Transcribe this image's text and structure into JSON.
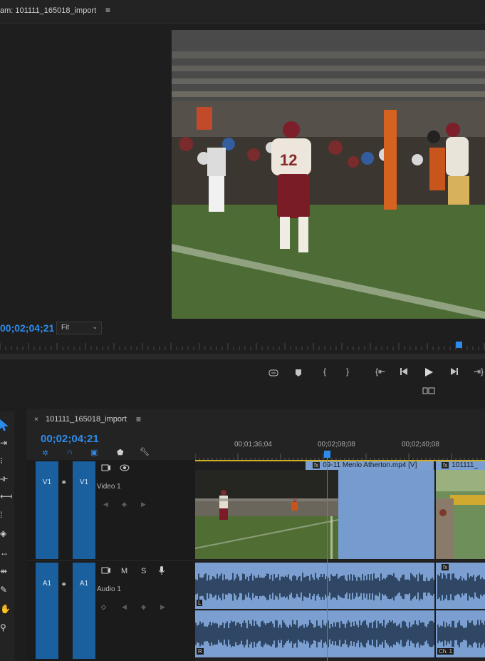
{
  "program_monitor": {
    "title": "am: 101111_165018_import",
    "menu_icon": "hamburger-icon",
    "timecode": "00;02;04;21",
    "zoom": "Fit",
    "transport": [
      {
        "name": "insert-marker-icon",
        "glyph": "⏏"
      },
      {
        "name": "add-marker-icon",
        "glyph": "⬟"
      },
      {
        "name": "mark-in-icon",
        "glyph": "{"
      },
      {
        "name": "mark-out-icon",
        "glyph": "}"
      },
      {
        "name": "go-to-in-icon",
        "glyph": "{⇤"
      },
      {
        "name": "step-back-icon",
        "glyph": "◂|"
      },
      {
        "name": "play-icon",
        "glyph": "▶"
      },
      {
        "name": "step-forward-icon",
        "glyph": "|▸"
      },
      {
        "name": "go-to-out-icon",
        "glyph": "⇥}"
      }
    ],
    "compare_icon": "compare-view-icon"
  },
  "timeline": {
    "tab_close": "×",
    "tab_label": "101111_165018_import",
    "timecode": "00;02;04;21",
    "ruler_labels": [
      "00;01;36;04",
      "00;02;08;08",
      "00;02;40;08"
    ],
    "tracks": {
      "v1": {
        "source": "V1",
        "target": "V1",
        "name": "Video 1"
      },
      "a1": {
        "source": "A1",
        "target": "A1",
        "name": "Audio 1",
        "m": "M",
        "s": "S"
      }
    },
    "clips": {
      "video_label": "09-11 Menlo Atherton.mp4 [V]",
      "video_label_2": "101111_",
      "fx_badge": "fx",
      "channel_left": "L",
      "channel_right": "R",
      "channel_label": "Ch. 1"
    }
  },
  "colors": {
    "accent": "#2d8ceb",
    "track_tag": "#1a5f9e",
    "clip_blue": "#769ccf",
    "audio_wave": "#7a9fd0"
  }
}
